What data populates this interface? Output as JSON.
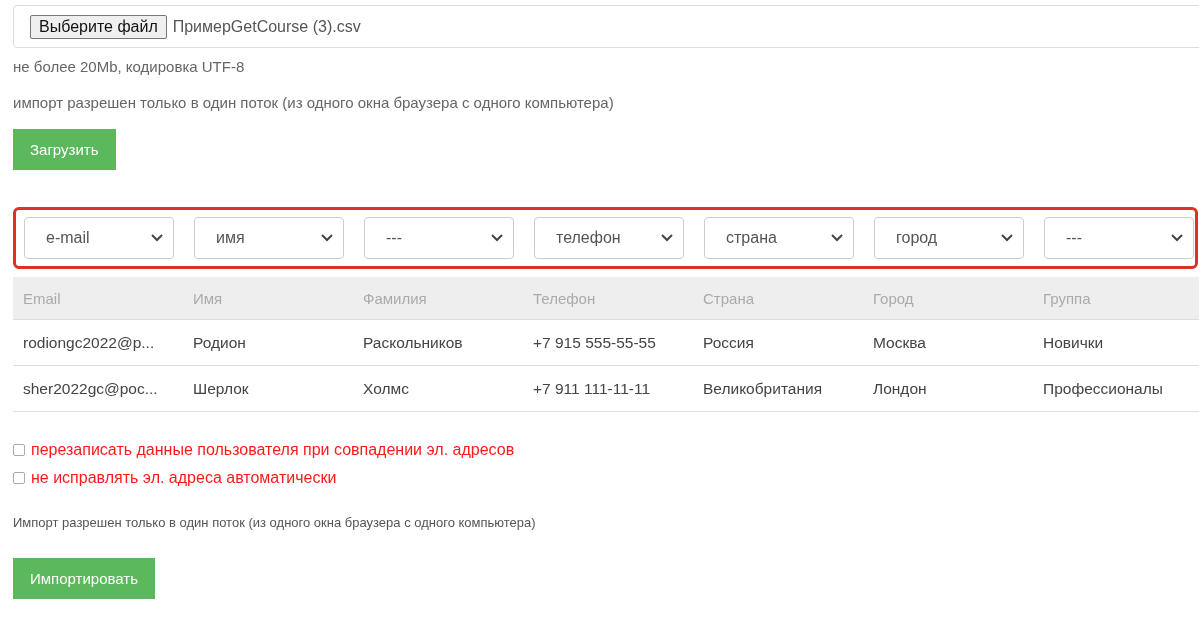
{
  "file_input": {
    "button": "Выберите файл",
    "file_name": "ПримерGetCourse (3).csv"
  },
  "hints": [
    "не более 20Mb, кодировка UTF-8",
    "импорт разрешен только в один поток (из одного окна браузера с одного компьютера)"
  ],
  "upload_button": "Загрузить",
  "mappings": [
    "e-mail",
    "имя",
    "---",
    "телефон",
    "страна",
    "город",
    "---"
  ],
  "table": {
    "columns": [
      "Email",
      "Имя",
      "Фамилия",
      "Телефон",
      "Страна",
      "Город",
      "Группа"
    ],
    "rows": [
      [
        "rodiongc2022@p...",
        "Родион",
        "Раскольников",
        "+7 915 555-55-55",
        "Россия",
        "Москва",
        "Новички"
      ],
      [
        "sher2022gc@poc...",
        "Шерлок",
        "Холмс",
        "+7 911 111-11-11",
        "Великобритания",
        "Лондон",
        "Профессионалы"
      ]
    ]
  },
  "options": [
    {
      "label": "перезаписать данные пользователя при совпадении эл. адресов",
      "checked": false
    },
    {
      "label": "не исправлять эл. адреса автоматически",
      "checked": false
    }
  ],
  "note": "Импорт разрешен только в один поток (из одного окна браузера с одного компьютера)",
  "import_button": "Импортировать"
}
